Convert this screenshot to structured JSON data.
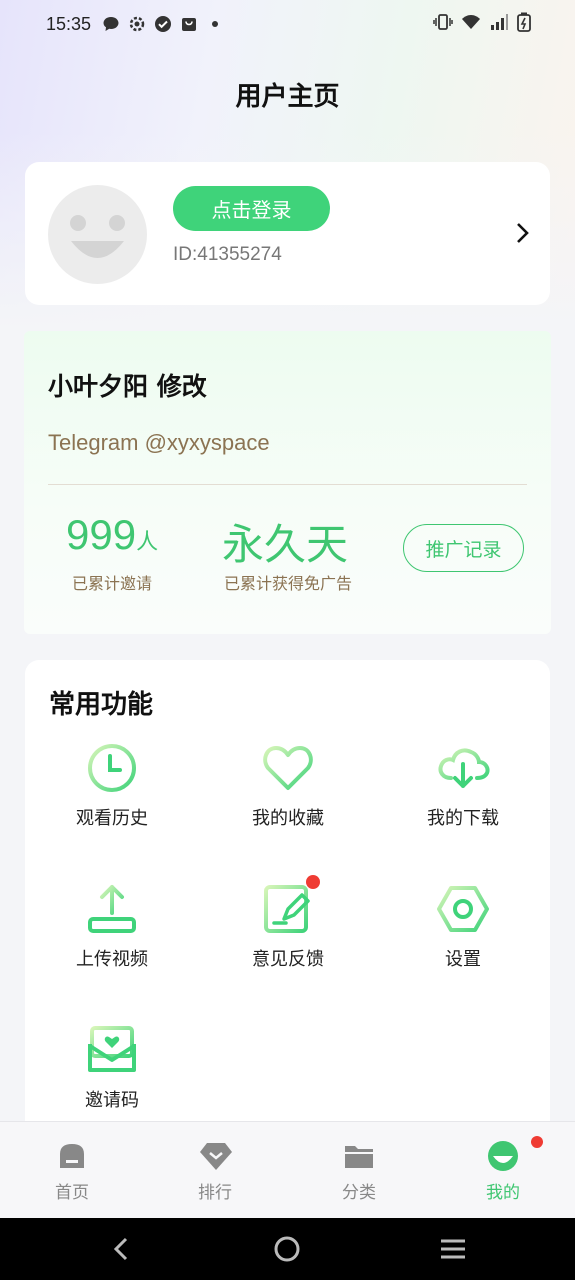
{
  "status_bar": {
    "time": "15:35"
  },
  "header": {
    "title": "用户主页"
  },
  "profile": {
    "login_label": "点击登录",
    "user_id": "ID:41355274"
  },
  "promo": {
    "title": "小叶夕阳 修改",
    "subtitle": "Telegram @xyxyspace",
    "stats": [
      {
        "value": "999",
        "unit": "人",
        "label": "已累计邀请"
      },
      {
        "value": "永久天",
        "unit": "",
        "label": "已累计获得免广告"
      }
    ],
    "record_label": "推广记录"
  },
  "functions": {
    "title": "常用功能",
    "items": [
      {
        "label": "观看历史",
        "icon": "clock-icon"
      },
      {
        "label": "我的收藏",
        "icon": "heart-icon"
      },
      {
        "label": "我的下载",
        "icon": "cloud-download-icon"
      },
      {
        "label": "上传视频",
        "icon": "upload-icon"
      },
      {
        "label": "意见反馈",
        "icon": "feedback-edit-icon"
      },
      {
        "label": "设置",
        "icon": "settings-hex-icon"
      },
      {
        "label": "邀请码",
        "icon": "invite-envelope-icon"
      }
    ]
  },
  "bottom_nav": {
    "items": [
      {
        "label": "首页",
        "icon": "home-icon",
        "active": false
      },
      {
        "label": "排行",
        "icon": "ranking-diamond-icon",
        "active": false
      },
      {
        "label": "分类",
        "icon": "folder-icon",
        "active": false
      },
      {
        "label": "我的",
        "icon": "profile-smile-icon",
        "active": true
      }
    ]
  },
  "colors": {
    "accent": "#3fc671",
    "button_green": "#3fd37a",
    "badge_red": "#ef3b33",
    "brown_text": "#8b7352"
  }
}
